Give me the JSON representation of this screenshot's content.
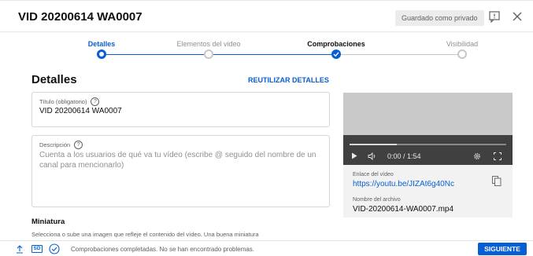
{
  "header": {
    "title": "VID 20200614 WA0007",
    "saved_badge": "Guardado como privado"
  },
  "stepper": {
    "steps": [
      {
        "label": "Detalles",
        "state": "active"
      },
      {
        "label": "Elementos del video",
        "state": "pending"
      },
      {
        "label": "Comprobaciones",
        "state": "done"
      },
      {
        "label": "Visibilidad",
        "state": "pending"
      }
    ]
  },
  "details": {
    "section_title": "Detalles",
    "reuse_link": "REUTILIZAR DETALLES",
    "title_field": {
      "label": "Título (obligatorio)",
      "value": "VID 20200614 WA0007"
    },
    "description_field": {
      "label": "Descripción",
      "placeholder": "Cuenta a los usuarios de qué va tu vídeo (escribe @ seguido del nombre de un canal para mencionarlo)"
    },
    "thumbnail": {
      "heading": "Miniatura",
      "text": "Selecciona o sube una imagen que refleje el contenido del vídeo. Una buena miniatura"
    }
  },
  "preview": {
    "time": "0:00 / 1:54",
    "link_label": "Enlace del vídeo",
    "link_value": "https://youtu.be/JIZAt6g40Nc",
    "filename_label": "Nombre del archivo",
    "filename_value": "VID-20200614-WA0007.mp4"
  },
  "footer": {
    "quality_badge": "SD",
    "status": "Comprobaciones completadas. No se han encontrado problemas.",
    "next_button": "SIGUIENTE"
  },
  "colors": {
    "accent": "#065fd4",
    "muted_text": "#606060",
    "border": "#d6d6d6"
  }
}
